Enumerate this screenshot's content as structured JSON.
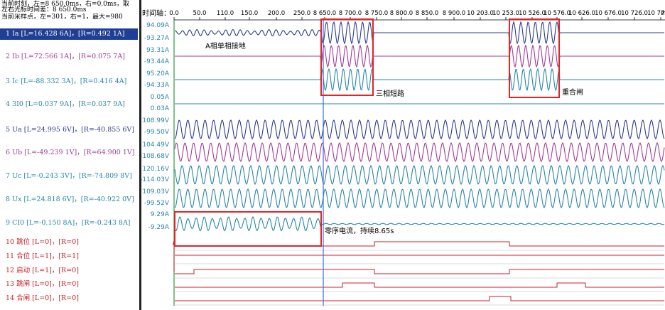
{
  "header": {
    "line1": "当前时刻，左=8 650.0ms，右=0.0ms，取",
    "line2": "左右光标时间差：8 650.0ms",
    "line3": "当前采样点，左=301，右=1，最大=980"
  },
  "time_axis": {
    "label": "时间轴：",
    "ticks": [
      "0.0",
      "50.0",
      "110.0",
      "150.0",
      "200.0",
      "250.0",
      "8 650.0",
      "8 700.0",
      "8 750.0",
      "8 800.0",
      "8 850.0",
      "8 900.0",
      "10 203.0",
      "10 253.0",
      "10 526.0",
      "10 576.0",
      "10 626.0",
      "10 676.0",
      "10 726.0",
      "10 776.0"
    ],
    "unit": "ms"
  },
  "channels": [
    {
      "id": 1,
      "label": "1 Ia  [L=16.428 6A]，[R=0.492 1A]",
      "color": "#2c3c8c",
      "selected": true,
      "max": "94.09A",
      "min": "-93.27A"
    },
    {
      "id": 2,
      "label": "2 Ib  [L=72.566 1A]，[R=0.075 7A]",
      "color": "#a03c96",
      "selected": false,
      "max": "93.31A",
      "min": "-93.44A"
    },
    {
      "id": 3,
      "label": "3 Ic  [L=-88.332 3A]，[R=0.416 4A]",
      "color": "#2a86a8",
      "selected": false,
      "max": "95.20A",
      "min": "-94.33A"
    },
    {
      "id": 4,
      "label": "4 3I0  [L=0.037 9A]，[R=0.037 9A]",
      "color": "#2a86a8",
      "selected": false,
      "max": "0.05A",
      "min": "0.03A"
    },
    {
      "id": 5,
      "label": "5 Ua  [L=24.995 6V]，[R=-40.855 6V]",
      "color": "#2c3c8c",
      "selected": false,
      "max": "108.99V",
      "min": "-99.50V"
    },
    {
      "id": 6,
      "label": "6 Ub  [L=-49.239 1V]，[R=64.900 1V]",
      "color": "#a03c96",
      "selected": false,
      "max": "104.49V",
      "min": "-108.68V"
    },
    {
      "id": 7,
      "label": "7 Uc  [L=-0.243 3V]，[R=-74.809 8V]",
      "color": "#2a86a8",
      "selected": false,
      "max": "120.16V",
      "min": "-114.03V"
    },
    {
      "id": 8,
      "label": "8 Ux  [L=24.818 6V]，[R=-40.922 0V]",
      "color": "#2a86a8",
      "selected": false,
      "max": "109.03V",
      "min": "-99.52V"
    },
    {
      "id": 9,
      "label": "9 CI0  [L=-0.150 8A]，[R=-0.243 8A]",
      "color": "#2a86a8",
      "selected": false,
      "max": "9.29A",
      "min": "-9.29A"
    },
    {
      "id": 10,
      "label": "10 跳位  [L=0]，[R=0]",
      "color": "#c8202a",
      "selected": false
    },
    {
      "id": 11,
      "label": "11 合位  [L=1]，[R=1]",
      "color": "#c8202a",
      "selected": false
    },
    {
      "id": 12,
      "label": "12 启动  [L=1]，[R=0]",
      "color": "#c8202a",
      "selected": false
    },
    {
      "id": 13,
      "label": "13 跳闸  [L=0]，[R=0]",
      "color": "#c8202a",
      "selected": false
    },
    {
      "id": 14,
      "label": "14 合闸  [L=0]，[R=0]",
      "color": "#c8202a",
      "selected": false
    }
  ],
  "annotations": {
    "single_phase": "A相单相接地",
    "three_phase": "三相短路",
    "reclose": "重合闸",
    "zero_seq": "零序电流，持续8.65s"
  },
  "colors": {
    "box": "#e0262a",
    "cursor": "#3a6fd8",
    "left_line": "#2e9a3a",
    "selected_bg": "#1f3f96"
  }
}
